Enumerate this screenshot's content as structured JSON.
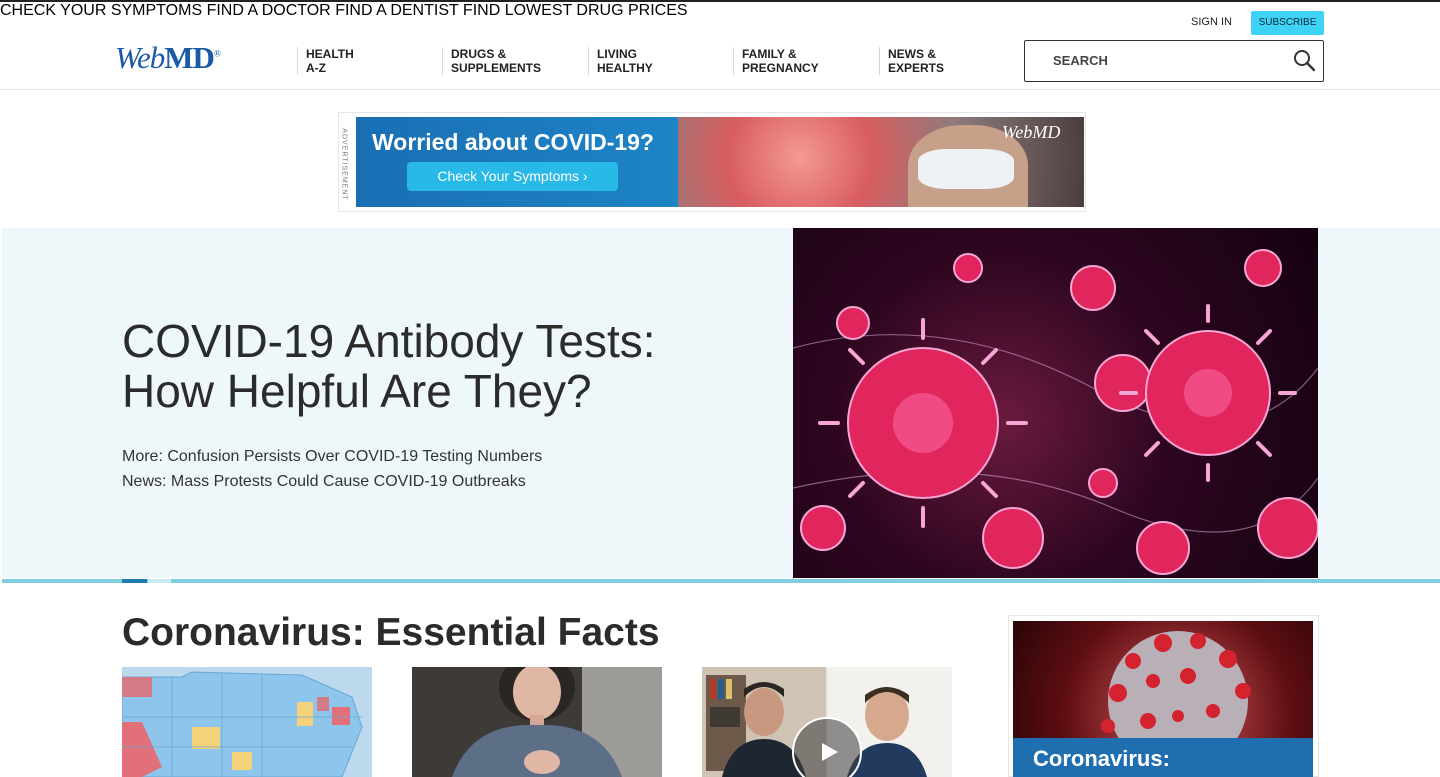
{
  "utility_nav": [
    "CHECK YOUR SYMPTOMS",
    "FIND A DOCTOR",
    "FIND A DENTIST",
    "FIND LOWEST DRUG PRICES"
  ],
  "logo": {
    "web": "Web",
    "md": "MD",
    "reg": "®"
  },
  "main_nav": [
    {
      "line1": "HEALTH",
      "line2": "A-Z"
    },
    {
      "line1": "DRUGS &",
      "line2": "SUPPLEMENTS"
    },
    {
      "line1": "LIVING",
      "line2": "HEALTHY"
    },
    {
      "line1": "FAMILY &",
      "line2": "PREGNANCY"
    },
    {
      "line1": "NEWS &",
      "line2": "EXPERTS"
    }
  ],
  "account": {
    "sign_in": "SIGN IN",
    "subscribe": "SUBSCRIBE"
  },
  "search": {
    "placeholder": "SEARCH"
  },
  "ad_banner": {
    "label": "ADVERTISEMENT",
    "headline": "Worried about COVID-19?",
    "button": "Check Your Symptoms",
    "brand": "WebMD"
  },
  "hero": {
    "title": "COVID-19 Antibody Tests: How Helpful Are They?",
    "links": [
      "More: Confusion Persists Over COVID-19 Testing Numbers",
      "News: Mass Protests Could Cause COVID-19 Outbreaks"
    ]
  },
  "section": {
    "title": "Coronavirus: Essential Facts"
  },
  "side_ad": {
    "text": "Coronavirus:"
  },
  "colors": {
    "accent": "#1f7bb6",
    "subscribe": "#3ed3f6",
    "hero_bg": "#eef8fa",
    "carousel_bar": "#7fcfdc"
  }
}
